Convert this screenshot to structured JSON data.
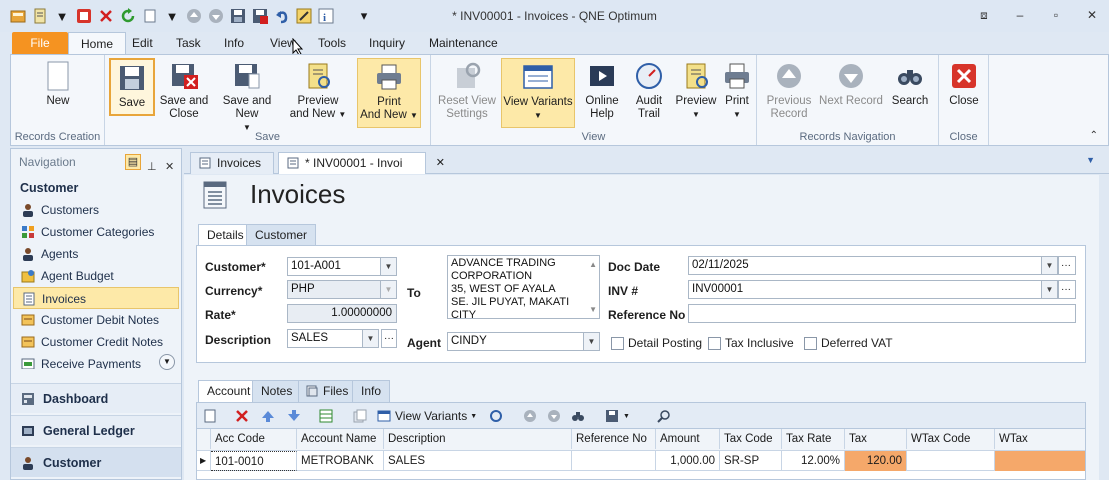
{
  "window": {
    "title": "* INV00001 - Invoices - QNE Optimum"
  },
  "menu_tabs": [
    "File",
    "Home",
    "Edit",
    "Task",
    "Info",
    "View",
    "Tools",
    "Inquiry",
    "Maintenance"
  ],
  "ribbon": {
    "groups": {
      "records_creation": "Records Creation",
      "save": "Save",
      "view": "View",
      "records_navigation": "Records Navigation",
      "close": "Close"
    },
    "buttons": {
      "new": "New",
      "save": "Save",
      "save_close_1": "Save and",
      "save_close_2": "Close",
      "save_new": "Save and New",
      "preview_new_1": "Preview",
      "preview_new_2": "and New",
      "print_new_1": "Print",
      "print_new_2": "And New",
      "reset_view_1": "Reset View",
      "reset_view_2": "Settings",
      "view_variants": "View Variants",
      "online_help_1": "Online",
      "online_help_2": "Help",
      "audit_trail_1": "Audit",
      "audit_trail_2": "Trail",
      "preview": "Preview",
      "print": "Print",
      "previous_record_1": "Previous",
      "previous_record_2": "Record",
      "next_record": "Next Record",
      "search": "Search",
      "close": "Close"
    }
  },
  "navigation": {
    "header": "Navigation",
    "section": "Customer",
    "items": [
      {
        "label": "Customers",
        "icon": "person-icon"
      },
      {
        "label": "Customer Categories",
        "icon": "categories-icon"
      },
      {
        "label": "Agents",
        "icon": "person-icon"
      },
      {
        "label": "Agent Budget",
        "icon": "budget-icon"
      },
      {
        "label": "Invoices",
        "icon": "document-icon"
      },
      {
        "label": "Customer Debit Notes",
        "icon": "note-icon"
      },
      {
        "label": "Customer Credit Notes",
        "icon": "note-icon"
      },
      {
        "label": "Receive Payments",
        "icon": "payment-icon"
      }
    ],
    "modules": [
      "Dashboard",
      "General Ledger",
      "Customer"
    ]
  },
  "doc_tabs": [
    "Invoices",
    "* INV00001 - Invoi"
  ],
  "page": {
    "title": "Invoices",
    "tabs": [
      "Details",
      "Customer"
    ]
  },
  "form": {
    "customer_label": "Customer*",
    "customer_value": "101-A001",
    "currency_label": "Currency*",
    "currency_value": "PHP",
    "rate_label": "Rate*",
    "rate_value": "1.00000000",
    "description_label": "Description",
    "description_value": "SALES",
    "to_label": "To",
    "to_address": [
      "ADVANCE TRADING",
      "CORPORATION",
      "35, WEST OF AYALA",
      "SE. JIL PUYAT, MAKATI",
      "CITY"
    ],
    "agent_label": "Agent",
    "agent_value": "CINDY",
    "doc_date_label": "Doc Date",
    "doc_date_value": "02/11/2025",
    "inv_label": "INV #",
    "inv_value": "INV00001",
    "reference_label": "Reference No",
    "reference_value": "",
    "detail_posting": "Detail Posting",
    "tax_inclusive": "Tax Inclusive",
    "deferred_vat": "Deferred VAT"
  },
  "lower_tabs": [
    "Account",
    "Notes",
    "Files",
    "Info"
  ],
  "grid_toolbar": {
    "view_variants": "View Variants"
  },
  "grid": {
    "columns": [
      "Acc Code",
      "Account Name",
      "Description",
      "Reference No",
      "Amount",
      "Tax Code",
      "Tax Rate",
      "Tax",
      "WTax Code",
      "WTax"
    ],
    "rows": [
      [
        "101-0010",
        "METROBANK",
        "SALES",
        "",
        "1,000.00",
        "SR-SP",
        "12.00%",
        "120.00",
        "",
        ""
      ]
    ]
  },
  "colors": {
    "file_tab": "#f59321",
    "highlight": "#fde9a8",
    "tax_cell": "#f5a86a"
  }
}
